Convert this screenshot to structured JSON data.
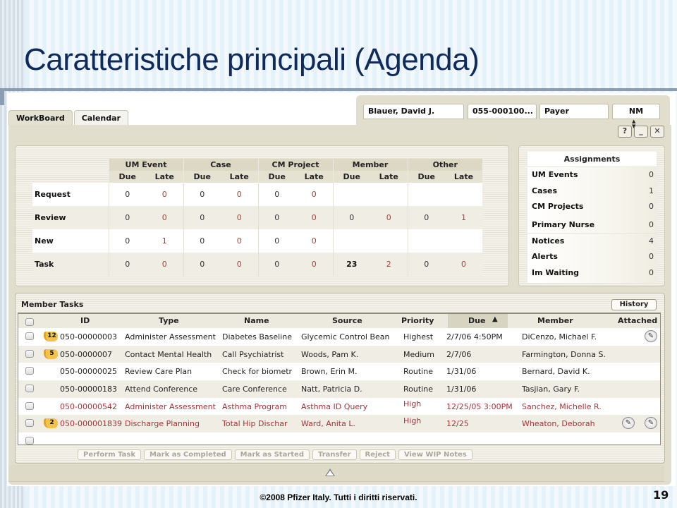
{
  "slide": {
    "title": "Caratteristiche principali (Agenda)",
    "footer": "©2008 Pfizer Italy. Tutti i diritti riservati.",
    "page_number": "19"
  },
  "app": {
    "tabs": [
      {
        "label": "WorkBoard",
        "active": true
      },
      {
        "label": "Calendar",
        "active": false
      }
    ],
    "header": {
      "member_name": "Blauer, David J.",
      "member_id": "055-000100...",
      "payer": "Payer",
      "nm": "NM",
      "help_label": "?",
      "minimize_label": "_",
      "close_label": "✕"
    },
    "summary": {
      "groups": [
        "UM Event",
        "Case",
        "CM Project",
        "Member",
        "Other"
      ],
      "sub_headers": [
        "Due",
        "Late"
      ],
      "rows": [
        {
          "label": "Request",
          "values": [
            "0",
            "0",
            "0",
            "0",
            "0",
            "0",
            "",
            "",
            "",
            ""
          ]
        },
        {
          "label": "Review",
          "values": [
            "0",
            "0",
            "0",
            "0",
            "0",
            "0",
            "0",
            "0",
            "0",
            "1"
          ]
        },
        {
          "label": "New",
          "values": [
            "0",
            "1",
            "0",
            "0",
            "0",
            "0",
            "",
            "",
            "",
            ""
          ]
        },
        {
          "label": "Task",
          "values": [
            "0",
            "0",
            "0",
            "0",
            "0",
            "0",
            "23",
            "2",
            "0",
            "0"
          ]
        }
      ]
    },
    "assignments": {
      "title": "Assignments",
      "items": [
        {
          "label": "UM Events",
          "value": "0"
        },
        {
          "label": "Cases",
          "value": "1"
        },
        {
          "label": "CM Projects",
          "value": "0"
        },
        {
          "label": "Primary Nurse",
          "value": "0"
        },
        {
          "label": "Notices",
          "value": "4"
        },
        {
          "label": "Alerts",
          "value": "0"
        },
        {
          "label": "Im Waiting",
          "value": "0"
        }
      ]
    },
    "member_tasks": {
      "title": "Member Tasks",
      "history_label": "History",
      "columns": [
        "ID",
        "Type",
        "Name",
        "Source",
        "Priority",
        "Due",
        "Member",
        "Attached"
      ],
      "sort_indicator": "▲",
      "rows": [
        {
          "flag": "12",
          "id": "050-00000003",
          "type": "Administer Assessment",
          "name": "Diabetes Baseline",
          "source": "Glycemic Control Bean",
          "priority": "Highest",
          "due": "2/7/06 4:50PM",
          "member": "DiCenzo, Michael F.",
          "attached": 1,
          "overdue": false
        },
        {
          "flag": "5",
          "id": "050-0000007",
          "type": "Contact Mental Health",
          "name": "Call Psychiatrist",
          "source": "Woods, Pam K.",
          "priority": "Medium",
          "due": "2/7/06",
          "member": "Farmington, Donna S.",
          "attached": 0,
          "overdue": false
        },
        {
          "flag": "",
          "id": "050-00000025",
          "type": "Review Care Plan",
          "name": "Check for biometr",
          "source": "Brown, Erin M.",
          "priority": "Routine",
          "due": "1/31/06",
          "member": "Bernard, David K.",
          "attached": 0,
          "overdue": false
        },
        {
          "flag": "",
          "id": "050-00000183",
          "type": "Attend Conference",
          "name": "Care Conference",
          "source": "Natt, Patricia D.",
          "priority": "Routine",
          "due": "1/31/06",
          "member": "Tasjian, Gary F.",
          "attached": 0,
          "overdue": false
        },
        {
          "flag": "",
          "id": "050-00000542",
          "type": "Administer Assessment",
          "name": "Asthma Program",
          "source": "Asthma ID Query",
          "priority": "High",
          "due": "12/25/05 3:00PM",
          "member": "Sanchez, Michelle R.",
          "attached": 0,
          "overdue": true
        },
        {
          "flag": "2",
          "id": "050-000001839",
          "type": "Discharge Planning",
          "name": "Total Hip Dischar",
          "source": "Ward, Anita L.",
          "priority": "High",
          "due": "12/25",
          "member": "Wheaton, Deborah",
          "attached": 2,
          "overdue": true
        }
      ],
      "actions": [
        "Perform Task",
        "Mark as Completed",
        "Mark as Started",
        "Transfer",
        "Reject",
        "View WIP Notes"
      ]
    },
    "colors": {
      "late_value": "#b23a3a",
      "overdue_row": "#a3343a",
      "frame": "#e1dece",
      "title": "#0f2a5c"
    }
  }
}
